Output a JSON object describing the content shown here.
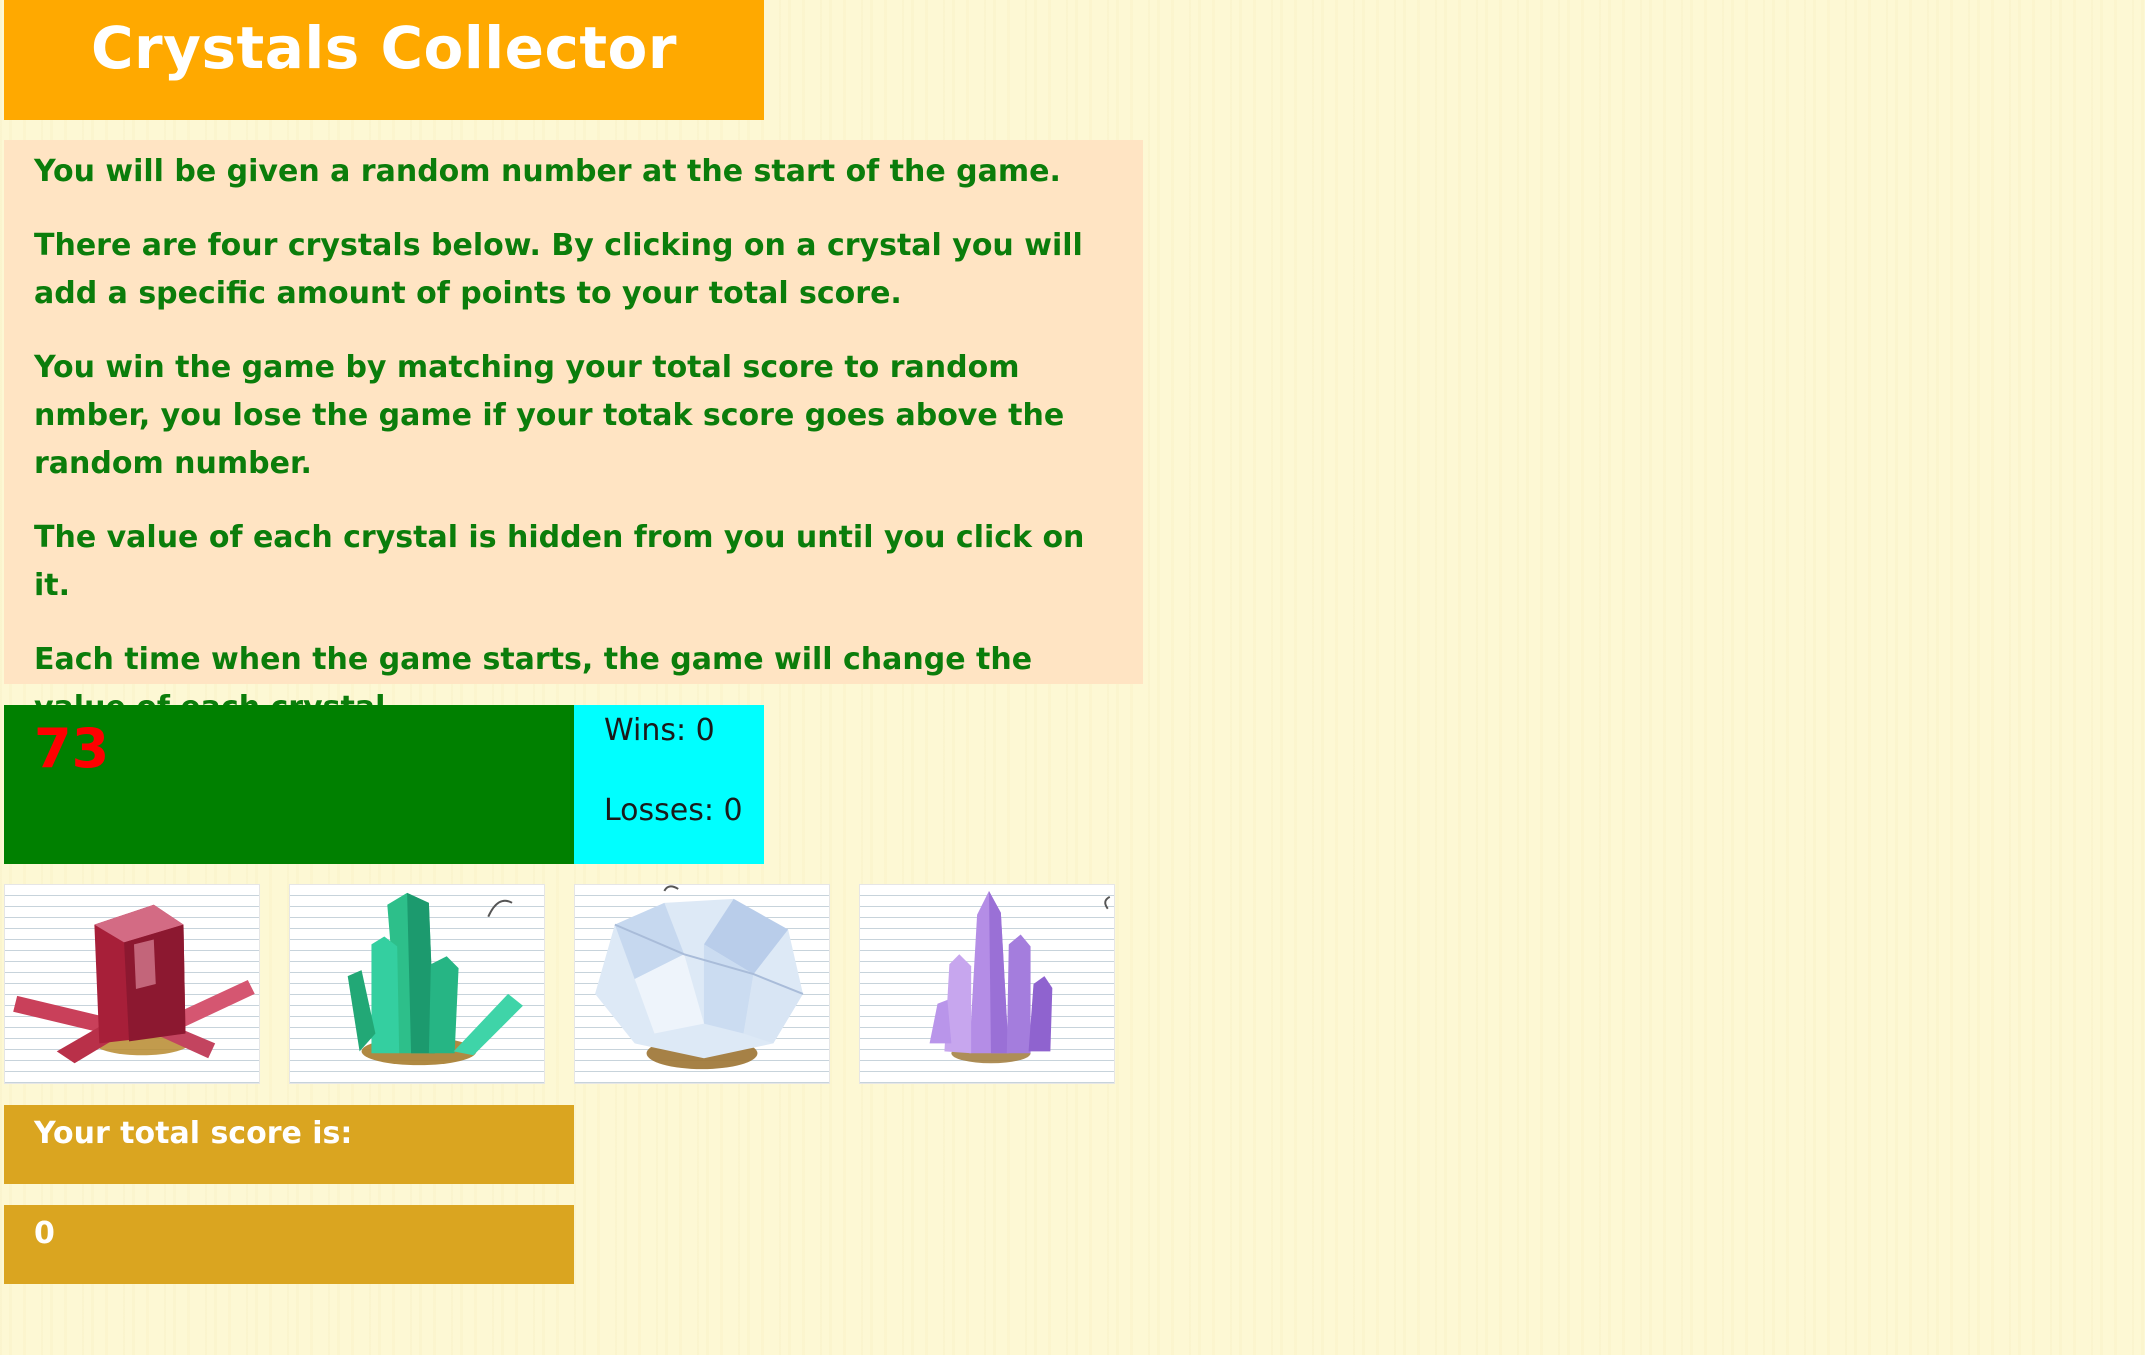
{
  "header": {
    "title": "Crystals Collector"
  },
  "instructions": [
    "You will be given a random number at the start of the game.",
    "There are four crystals below. By clicking on a crystal you will add a specific amount of points to your total score.",
    "You win the game by matching your total score to random nmber, you lose the game if your totak score goes above the random number.",
    "The value of each crystal is hidden from you until you click on it.",
    "Each time when the game starts, the game will change the value of each crystal."
  ],
  "game": {
    "target_number": "73",
    "wins_text": "Wins: 0",
    "losses_text": "Losses: 0",
    "score_label": "Your total score is:",
    "score_value": "0"
  },
  "crystals": [
    {
      "name": "red-crystal-icon",
      "color": "#c0283e"
    },
    {
      "name": "green-crystal-icon",
      "color": "#2fbf8c"
    },
    {
      "name": "clear-crystal-icon",
      "color": "#cfe0f2"
    },
    {
      "name": "purple-crystal-icon",
      "color": "#a77be0"
    }
  ],
  "colors": {
    "title_bg": "#ffa900",
    "instructions_bg": "#ffe4c3",
    "instructions_text": "#0b7d0b",
    "target_bg": "#008000",
    "target_text": "#ff0000",
    "stats_bg": "#00ffff",
    "score_bg": "#daa520"
  }
}
